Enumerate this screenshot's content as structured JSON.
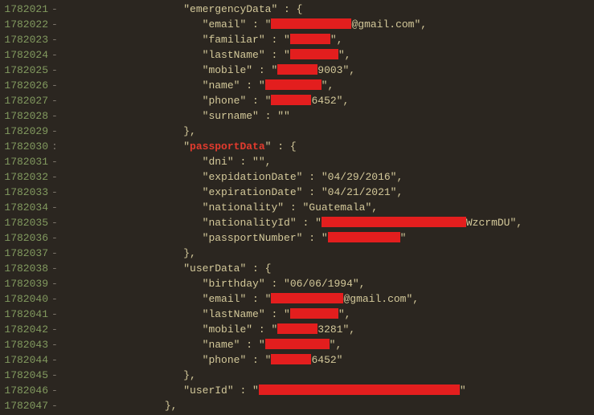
{
  "lines": {
    "l0": {
      "num": "1782021",
      "mk": "-",
      "indent": "                   ",
      "text1": "\"emergencyData\" : {"
    },
    "l1": {
      "num": "1782022",
      "mk": "-",
      "indent": "                      ",
      "k": "\"email\" : \"",
      "v_after": "@gmail.com\","
    },
    "l2": {
      "num": "1782023",
      "mk": "-",
      "indent": "                      ",
      "k": "\"familiar\" : \"",
      "v_after": "\","
    },
    "l3": {
      "num": "1782024",
      "mk": "-",
      "indent": "                      ",
      "k": "\"lastName\" : \"",
      "v_after": "\","
    },
    "l4": {
      "num": "1782025",
      "mk": "-",
      "indent": "                      ",
      "k": "\"mobile\" : \"",
      "v_after": "9003\","
    },
    "l5": {
      "num": "1782026",
      "mk": "-",
      "indent": "                      ",
      "k": "\"name\" : \"",
      "v_after": "\","
    },
    "l6": {
      "num": "1782027",
      "mk": "-",
      "indent": "                      ",
      "k": "\"phone\" : \"",
      "v_after": "6452\","
    },
    "l7": {
      "num": "1782028",
      "mk": "-",
      "indent": "                      ",
      "k": "\"surname\" : \"\""
    },
    "l8": {
      "num": "1782029",
      "mk": "-",
      "indent": "                   ",
      "text1": "},"
    },
    "l9": {
      "num": "1782030",
      "mk": ":",
      "indent": "                   ",
      "pre": "\"",
      "hl": "passportData",
      "post": "\" : {"
    },
    "l10": {
      "num": "1782031",
      "mk": "-",
      "indent": "                      ",
      "k": "\"dni\" : \"\","
    },
    "l11": {
      "num": "1782032",
      "mk": "-",
      "indent": "                      ",
      "k": "\"expidationDate\" : \"04/29/2016\","
    },
    "l12": {
      "num": "1782033",
      "mk": "-",
      "indent": "                      ",
      "k": "\"expirationDate\" : \"04/21/2021\","
    },
    "l13": {
      "num": "1782034",
      "mk": "-",
      "indent": "                      ",
      "k": "\"nationality\" : \"Guatemala\","
    },
    "l14": {
      "num": "1782035",
      "mk": "-",
      "indent": "                      ",
      "k": "\"nationalityId\" : \"",
      "v_after": "WzcrmDU\","
    },
    "l15": {
      "num": "1782036",
      "mk": "-",
      "indent": "                      ",
      "k": "\"passportNumber\" : \"",
      "v_after": "\""
    },
    "l16": {
      "num": "1782037",
      "mk": "-",
      "indent": "                   ",
      "text1": "},"
    },
    "l17": {
      "num": "1782038",
      "mk": "-",
      "indent": "                   ",
      "text1": "\"userData\" : {"
    },
    "l18": {
      "num": "1782039",
      "mk": "-",
      "indent": "                      ",
      "k": "\"birthday\" : \"06/06/1994\","
    },
    "l19": {
      "num": "1782040",
      "mk": "-",
      "indent": "                      ",
      "k": "\"email\" : \"",
      "v_after": "@gmail.com\","
    },
    "l20": {
      "num": "1782041",
      "mk": "-",
      "indent": "                      ",
      "k": "\"lastName\" : \"",
      "v_after": "\","
    },
    "l21": {
      "num": "1782042",
      "mk": "-",
      "indent": "                      ",
      "k": "\"mobile\" : \"",
      "v_after": "3281\","
    },
    "l22": {
      "num": "1782043",
      "mk": "-",
      "indent": "                      ",
      "k": "\"name\" : \"",
      "v_after": "\","
    },
    "l23": {
      "num": "1782044",
      "mk": "-",
      "indent": "                      ",
      "k": "\"phone\" : \"",
      "v_after": "6452\""
    },
    "l24": {
      "num": "1782045",
      "mk": "-",
      "indent": "                   ",
      "text1": "},"
    },
    "l25": {
      "num": "1782046",
      "mk": "-",
      "indent": "                   ",
      "k": "\"userId\" : \"",
      "v_after": "\""
    },
    "l26": {
      "num": "1782047",
      "mk": "-",
      "indent": "                ",
      "text1": "},"
    }
  }
}
